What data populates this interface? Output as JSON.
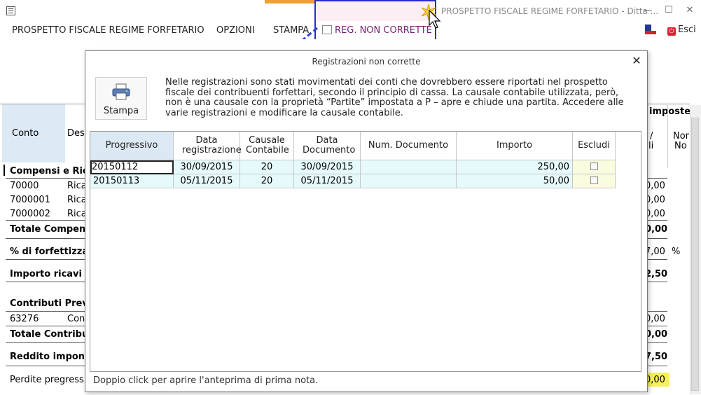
{
  "window": {
    "title": "PROSPETTO FISCALE REGIME FORFETARIO - Ditta ...",
    "minimize": "—",
    "maximize": "☐",
    "close": "✕"
  },
  "menu": {
    "items": [
      "PROSPETTO FISCALE REGIME FORFETARIO",
      "OPZIONI",
      "STAMPA"
    ],
    "active": "REG. NON CORRETTE",
    "exit": "Esci",
    "highlight_color": "#2b2bd6",
    "active_color": "#7a2070"
  },
  "background": {
    "head": {
      "conto": "Conto",
      "desc": "Desc",
      "imposte": "imposte",
      "col_a": "/",
      "col_a2": "li",
      "col_b": "Nor",
      "col_b2": "No"
    },
    "rows": [
      {
        "key": "compensi_header",
        "left": "Compensi e Rica",
        "right": ""
      },
      {
        "key": "r1",
        "code": "70000",
        "desc": "Rica",
        "right": "0,00"
      },
      {
        "key": "r2",
        "code": "7000001",
        "desc": "Rica",
        "right": "0,00"
      },
      {
        "key": "r3",
        "code": "7000002",
        "desc": "Rica",
        "right": "0,00"
      },
      {
        "key": "totale_compensi",
        "left": "Totale Compensi",
        "right": "0,00"
      },
      {
        "key": "forfettizzazione",
        "left": "% di forfettizzazi",
        "right": "7,00",
        "unit": "%"
      },
      {
        "key": "importo_ricavi",
        "left": "Importo ricavi fo",
        "right": "2,50"
      },
      {
        "key": "contributi_header",
        "left": "Contributi Previ"
      },
      {
        "key": "r4",
        "code": "63276",
        "desc": "Con",
        "right": "0,00"
      },
      {
        "key": "totale_contributi",
        "left": "Totale Contribut",
        "right": "0,00"
      },
      {
        "key": "reddito",
        "left": "Reddito imponib",
        "right": "7,50"
      },
      {
        "key": "perdite",
        "left": "Perdite pregress",
        "right": "0,00"
      }
    ]
  },
  "dialog": {
    "title": "Registrazioni non corrette",
    "close": "✕",
    "print_button": "Stampa",
    "message": "Nelle registrazioni sono stati movimentati dei conti che dovrebbero essere riportati nel prospetto fiscale dei contribuenti forfettari, secondo il principio di cassa. La causale contabile utilizzata, però,  non è una causale con la proprietà “Partite” impostata a P – apre e chiude una partita. Accedere alle varie registrazioni e modificare la causale contabile.",
    "columns": [
      "Progressivo",
      "Data registrazione",
      "Causale Contabile",
      "Data Documento",
      "Num. Documento",
      "Importo",
      "Escludi"
    ],
    "rows": [
      {
        "progressivo": "20150112",
        "data_registrazione": "30/09/2015",
        "causale": "20",
        "data_documento": "30/09/2015",
        "num_documento": "",
        "importo": "250,00",
        "escludi": false
      },
      {
        "progressivo": "20150113",
        "data_registrazione": "05/11/2015",
        "causale": "20",
        "data_documento": "05/11/2015",
        "num_documento": "",
        "importo": "50,00",
        "escludi": false
      }
    ],
    "footer": "Doppio click per aprire l'anteprima di prima nota."
  }
}
